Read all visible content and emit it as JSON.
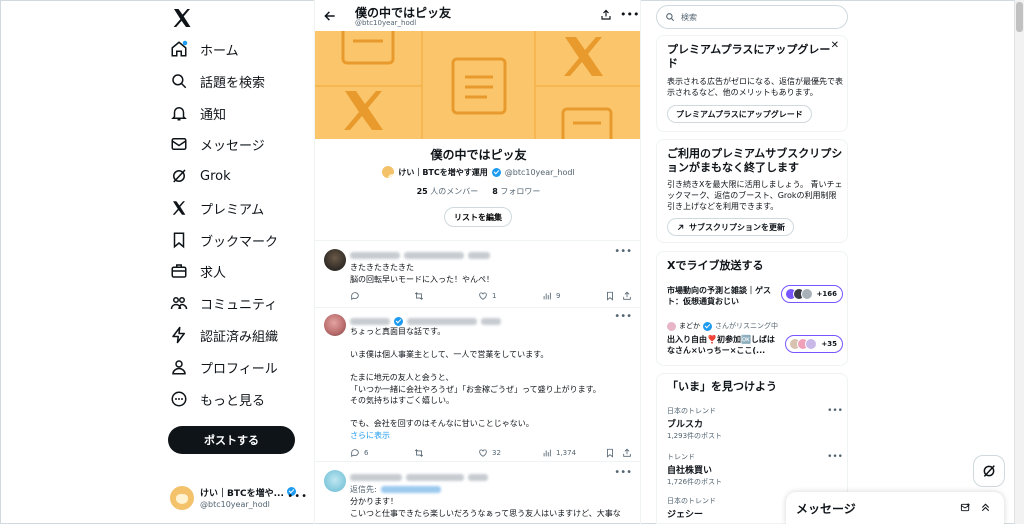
{
  "nav": {
    "items": [
      {
        "label": "ホーム",
        "icon": "home-icon"
      },
      {
        "label": "話題を検索",
        "icon": "search-icon"
      },
      {
        "label": "通知",
        "icon": "bell-icon"
      },
      {
        "label": "メッセージ",
        "icon": "mail-icon"
      },
      {
        "label": "Grok",
        "icon": "grok-icon"
      },
      {
        "label": "プレミアム",
        "icon": "x-logo-icon"
      },
      {
        "label": "ブックマーク",
        "icon": "bookmark-icon"
      },
      {
        "label": "求人",
        "icon": "briefcase-icon"
      },
      {
        "label": "コミュニティ",
        "icon": "community-icon"
      },
      {
        "label": "認証済み組織",
        "icon": "lightning-icon"
      },
      {
        "label": "プロフィール",
        "icon": "person-icon"
      },
      {
        "label": "もっと見る",
        "icon": "more-circle-icon"
      }
    ],
    "post_label": "ポストする"
  },
  "account": {
    "name": "けい｜BTCを増や...",
    "handle": "@btc10year_hodl"
  },
  "header": {
    "title": "僕の中ではピッ友",
    "handle": "@btc10year_hodl"
  },
  "list": {
    "title": "僕の中ではピッ友",
    "owner_name": "けい｜BTCを増やす運用",
    "owner_handle": "@btc10year_hodl",
    "members_count": "25",
    "members_label": "人のメンバー",
    "followers_count": "8",
    "followers_label": "フォロワー",
    "edit_label": "リストを編集"
  },
  "tweets": [
    {
      "text": "きたきたきたきた\n脳の回転早いモードに入った！やんぺ！",
      "replies": "",
      "reposts": "",
      "likes": "1",
      "views": "9"
    },
    {
      "text": "ちょっと真面目な話です。\n\nいま僕は個人事業主として、一人で営業をしています。\n\nたまに地元の友人と会うと、\n「いつか一緒に会社やろうぜ」「お金稼ごうぜ」って盛り上がります。\nその気持ちはすごく嬉しい。\n\nでも、会社を回すのはそんなに甘いことじゃない。",
      "show_more": "さらに表示",
      "replies": "6",
      "reposts": "",
      "likes": "32",
      "views": "1,374"
    },
    {
      "reply_prefix": "返信先:",
      "text": "分かります！\nこいつと仕事できたら楽しいだろうなぁって思う友人はいますけど、大事な"
    }
  ],
  "search": {
    "placeholder": "検索"
  },
  "premium_card": {
    "title": "プレミアムプラスにアップグレード",
    "body": "表示される広告がゼロになる、返信が最優先で表示されるなど、他のメリットもあります。",
    "button": "プレミアムプラスにアップグレード"
  },
  "subscription_card": {
    "title": "ご利用のプレミアムサブスクリプションがまもなく終了します",
    "body": "引き続きXを最大限に活用しましょう。 青いチェックマーク、返信のブースト、Grokの利用制限引き上げなどを利用できます。",
    "button": "サブスクリプションを更新"
  },
  "live": {
    "title": "Xでライブ放送する",
    "items": [
      {
        "title": "市場動向の予測と雑談｜ゲスト：仮想通貨おじい",
        "count": "+166"
      },
      {
        "host": "まどか",
        "host_suffix": "さんがリスニング中",
        "title": "出入り自由❣️初参加🆗しばはなさん×いっちー×ここ(...",
        "count": "+35"
      }
    ]
  },
  "trends": {
    "title": "「いま」を見つけよう",
    "items": [
      {
        "category": "日本のトレンド",
        "name": "ブルスカ",
        "count": "1,293件のポスト"
      },
      {
        "category": "トレンド",
        "name": "自社株買い",
        "count": "1,726件のポスト"
      },
      {
        "category": "日本のトレンド",
        "name": "ジェシー",
        "count": ""
      }
    ]
  },
  "messages_dock": {
    "title": "メッセージ"
  },
  "colors": {
    "accent": "#1d9bf0",
    "banner": "#fbc66b",
    "live": "#7856ff"
  }
}
